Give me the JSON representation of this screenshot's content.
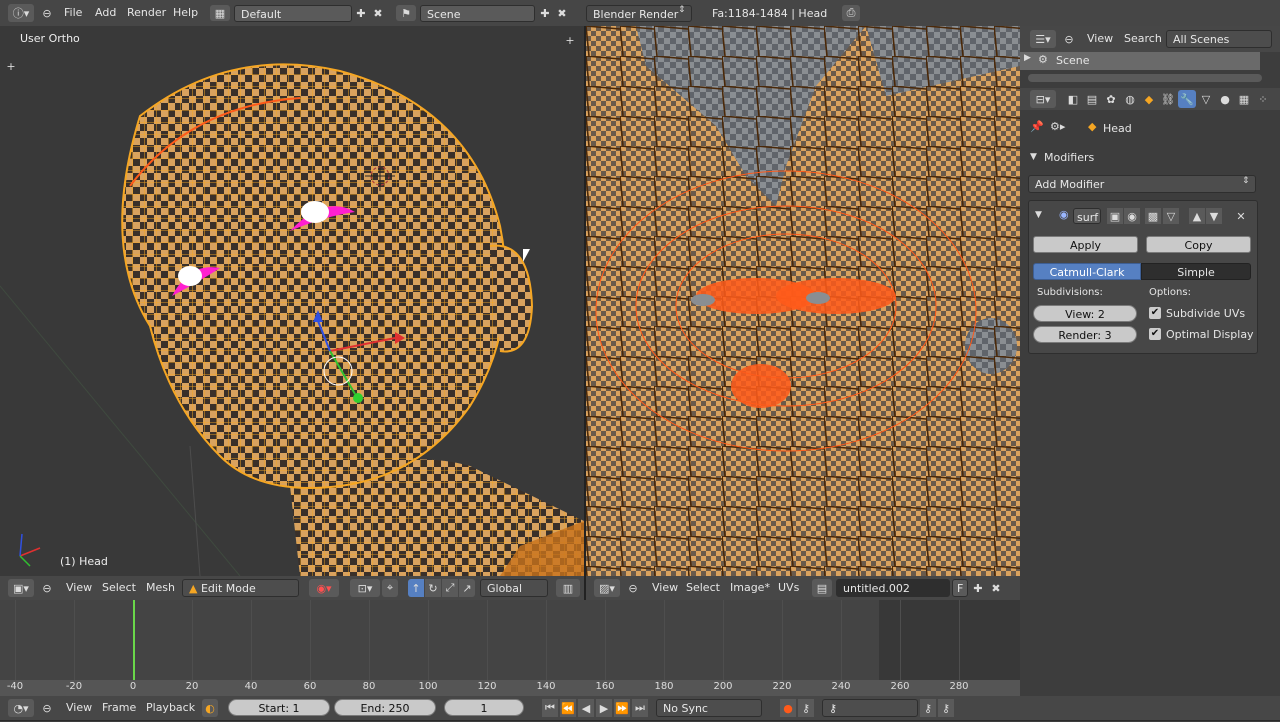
{
  "top_bar": {
    "menus": [
      "File",
      "Add",
      "Render",
      "Help"
    ],
    "layout": "Default",
    "scene": "Scene",
    "engine": "Blender Render",
    "stats": "Fa:1184-1484 | Head"
  },
  "viewport3d": {
    "view_name": "User Ortho",
    "object_label": "(1) Head",
    "header": {
      "menus": [
        "View",
        "Select",
        "Mesh"
      ],
      "mode": "Edit Mode",
      "orientation": "Global"
    }
  },
  "uv_editor": {
    "header": {
      "menus": [
        "View",
        "Select",
        "Image*",
        "UVs"
      ],
      "image_name": "untitled.002",
      "f_label": "F"
    }
  },
  "outliner": {
    "menus": [
      "View",
      "Search"
    ],
    "filter": "All Scenes",
    "scene_item": "Scene"
  },
  "properties": {
    "breadcrumb": "Head",
    "section": "Modifiers",
    "add_modifier": "Add Modifier",
    "modifier_name": "surf",
    "apply": "Apply",
    "copy": "Copy",
    "type_tabs": [
      "Catmull-Clark",
      "Simple"
    ],
    "active_type": "Catmull-Clark",
    "subdivisions_label": "Subdivisions:",
    "view_level": "View: 2",
    "render_level": "Render: 3",
    "options_label": "Options:",
    "subdivide_uvs": "Subdivide UVs",
    "optimal_display": "Optimal Display",
    "subdivide_uvs_checked": true,
    "optimal_display_checked": true
  },
  "timeline": {
    "ruler": [
      "-40",
      "-20",
      "0",
      "20",
      "40",
      "60",
      "80",
      "100",
      "120",
      "140",
      "160",
      "180",
      "200",
      "220",
      "240",
      "260",
      "280"
    ],
    "current_frame_marker": 0,
    "header": {
      "menus": [
        "View",
        "Frame",
        "Playback"
      ],
      "start": "Start: 1",
      "end": "End: 250",
      "current": "1",
      "sync": "No Sync"
    }
  },
  "colors": {
    "mesh_wire": "#f5a623",
    "selected_vertex": "#ff5a1a",
    "eye": "#ff1fd0",
    "active_tab": "#5680c2",
    "frame_marker": "#6ad84a"
  }
}
